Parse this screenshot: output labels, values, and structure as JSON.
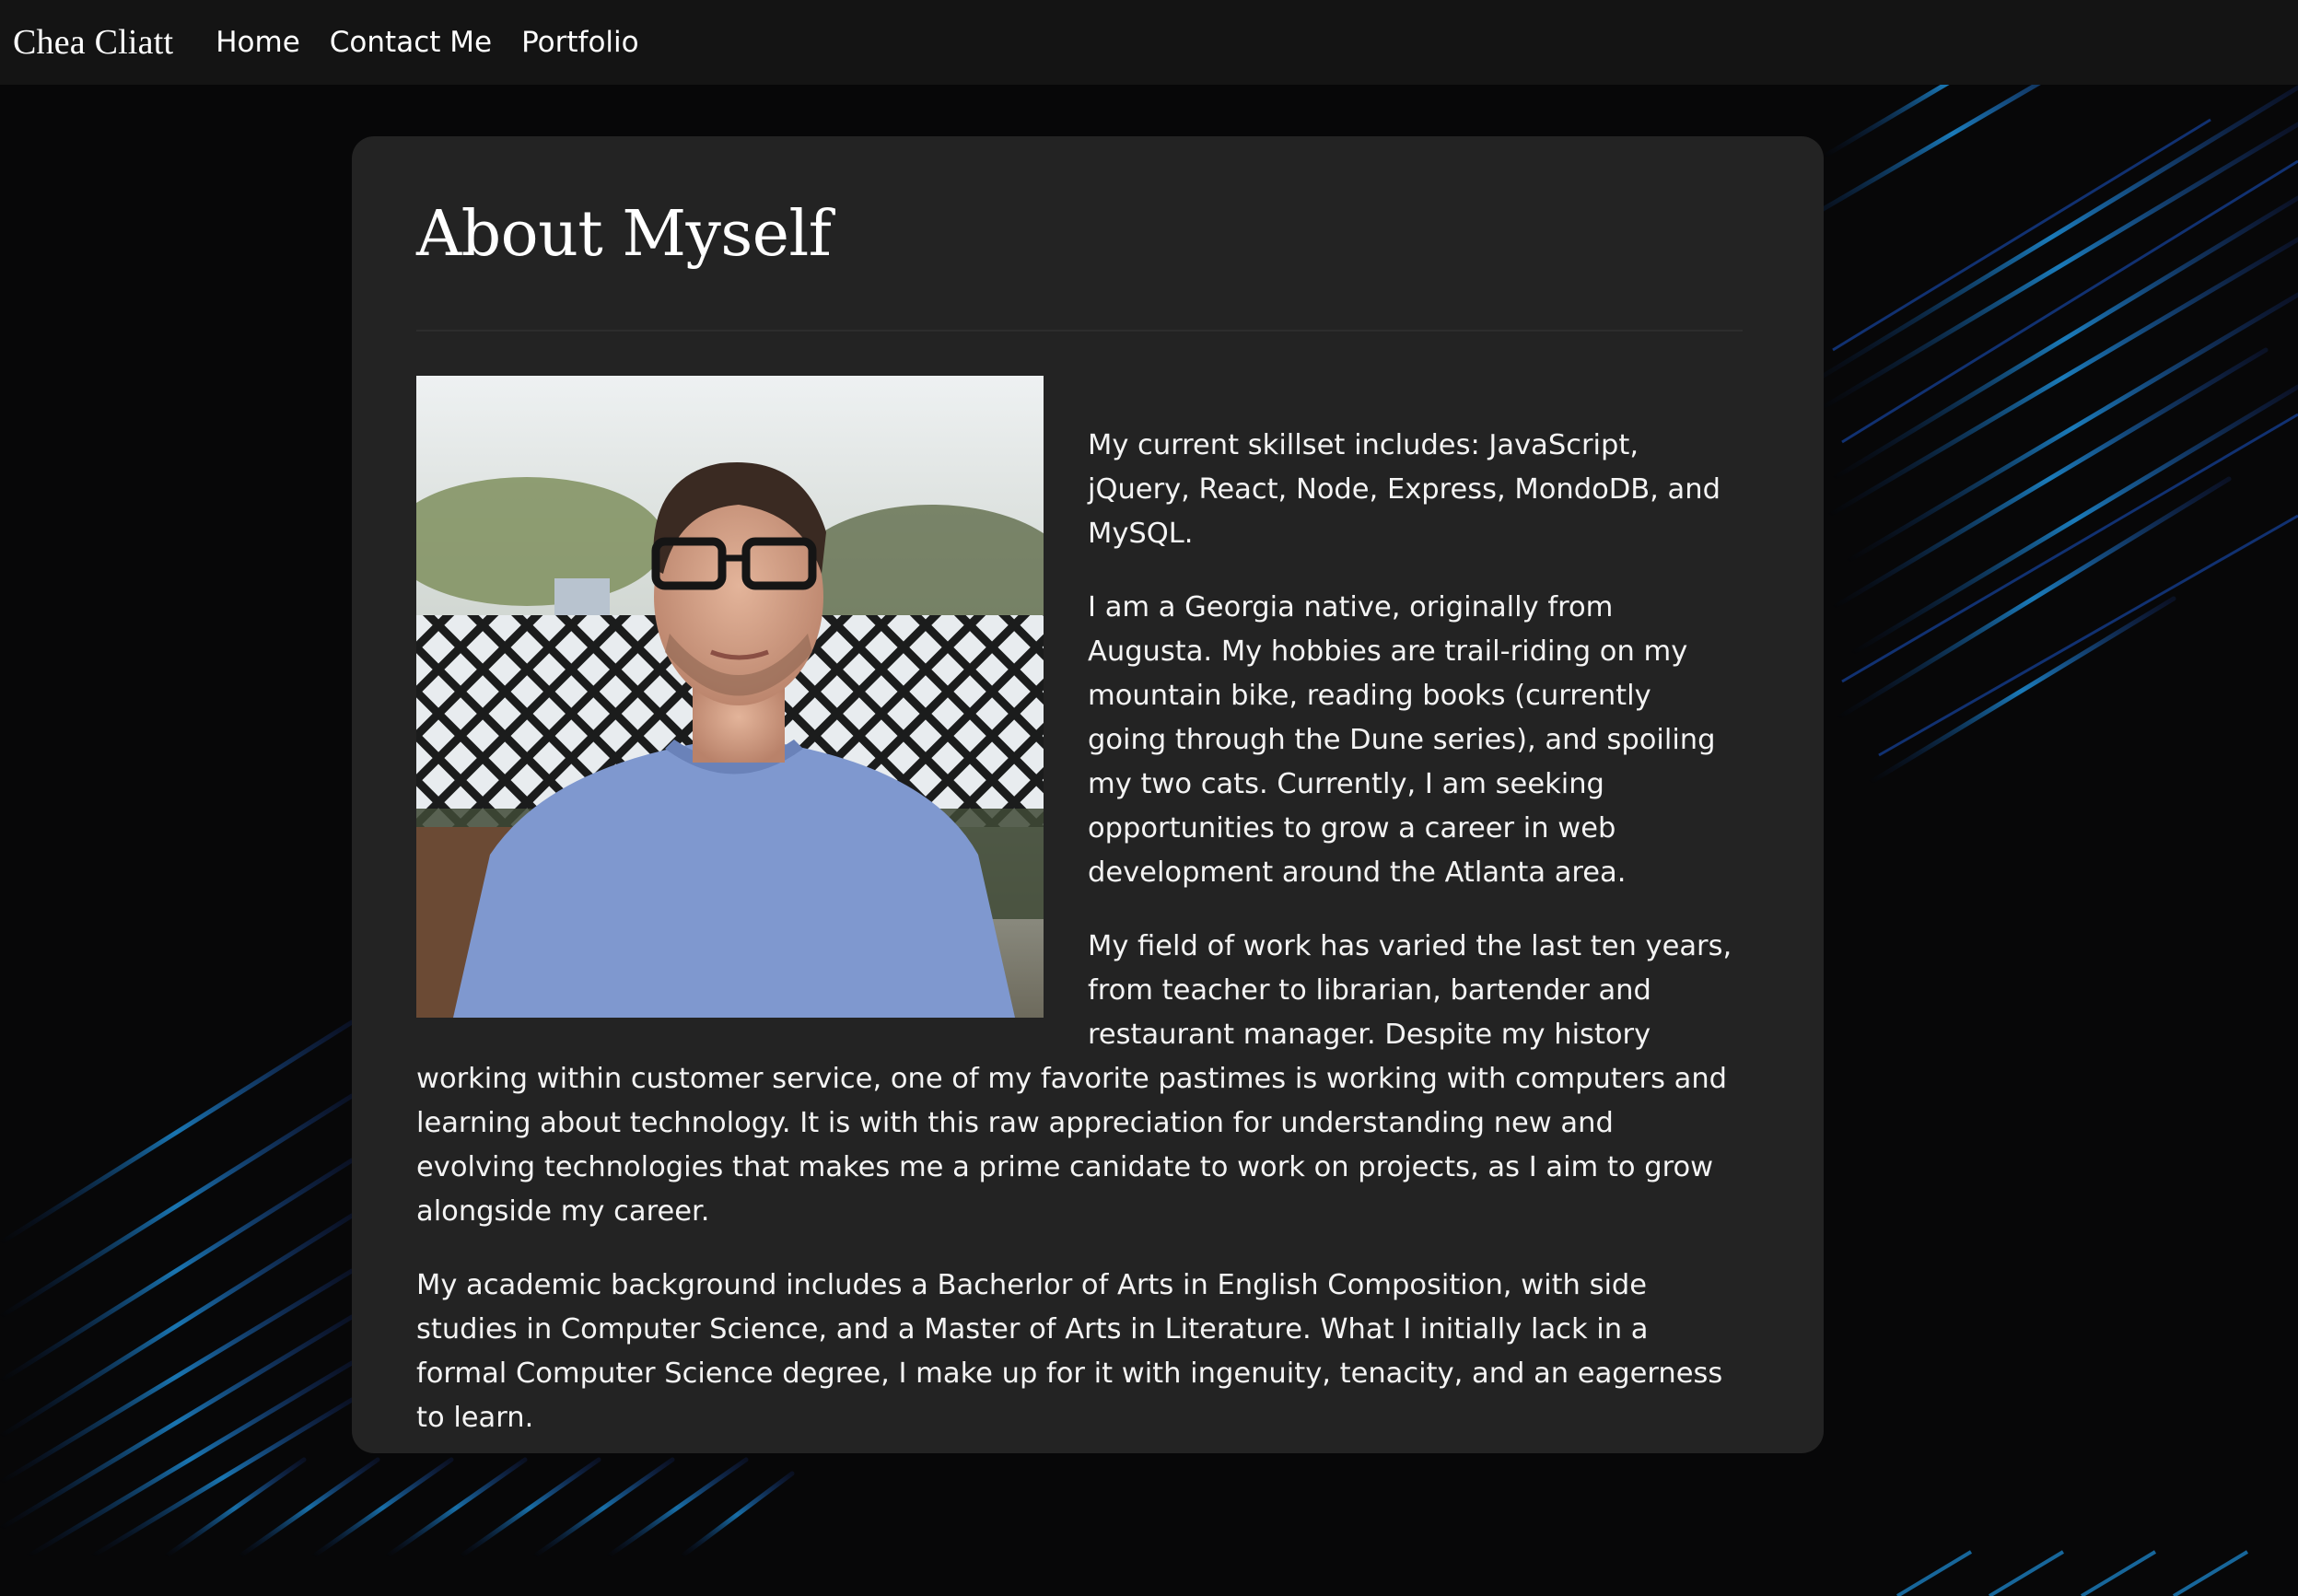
{
  "navbar": {
    "brand": "Chea Cliatt",
    "links": [
      "Home",
      "Contact Me",
      "Portfolio"
    ]
  },
  "about": {
    "title": "About Myself",
    "photo_alt": "portrait-photo",
    "paragraphs": [
      "My current skillset includes: JavaScript, jQuery, React, Node, Express, MondoDB, and MySQL.",
      "I am a Georgia native, originally from Augusta. My hobbies are trail-riding on my mountain bike, reading books (currently going through the Dune series), and spoiling my two cats. Currently, I am seeking opportunities to grow a career in web development around the Atlanta area.",
      "My field of work has varied the last ten years, from teacher to librarian, bartender and restaurant manager. Despite my history working within customer service, one of my favorite pastimes is working with computers and learning about technology. It is with this raw appreciation for understanding new and evolving technologies that makes me a prime canidate to work on projects, as I aim to grow alongside my career.",
      "My academic background includes a Bacherlor of Arts in English Composition, with side studies in Computer Science, and a Master of Arts in Literature. What I initially lack in a formal Computer Science degree, I make up for it with ingenuity, tenacity, and an eagerness to learn."
    ]
  },
  "colors": {
    "page_background": "#070708",
    "navbar_background": "#141414",
    "card_background": "#232323",
    "streak_accent": "#1ea0e6",
    "text": "#f4f4f4"
  }
}
